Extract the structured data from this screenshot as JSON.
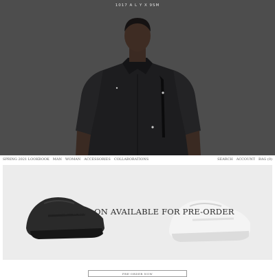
{
  "header": {
    "brand": "1017 A L Y X 9SM"
  },
  "nav": {
    "left": [
      "SPRING 2021 LOOKBOOK",
      "MAN",
      "WOMAN",
      "ACCESSORIES",
      "COLLABORATIONS"
    ],
    "right": [
      "SEARCH",
      "ACCOUNT",
      "BAG (0)"
    ]
  },
  "banner": {
    "headline": "MONO SLIP ON AVAILABLE FOR PRE-ORDER"
  },
  "cta": {
    "label": "PRE-ORDER NOW"
  }
}
